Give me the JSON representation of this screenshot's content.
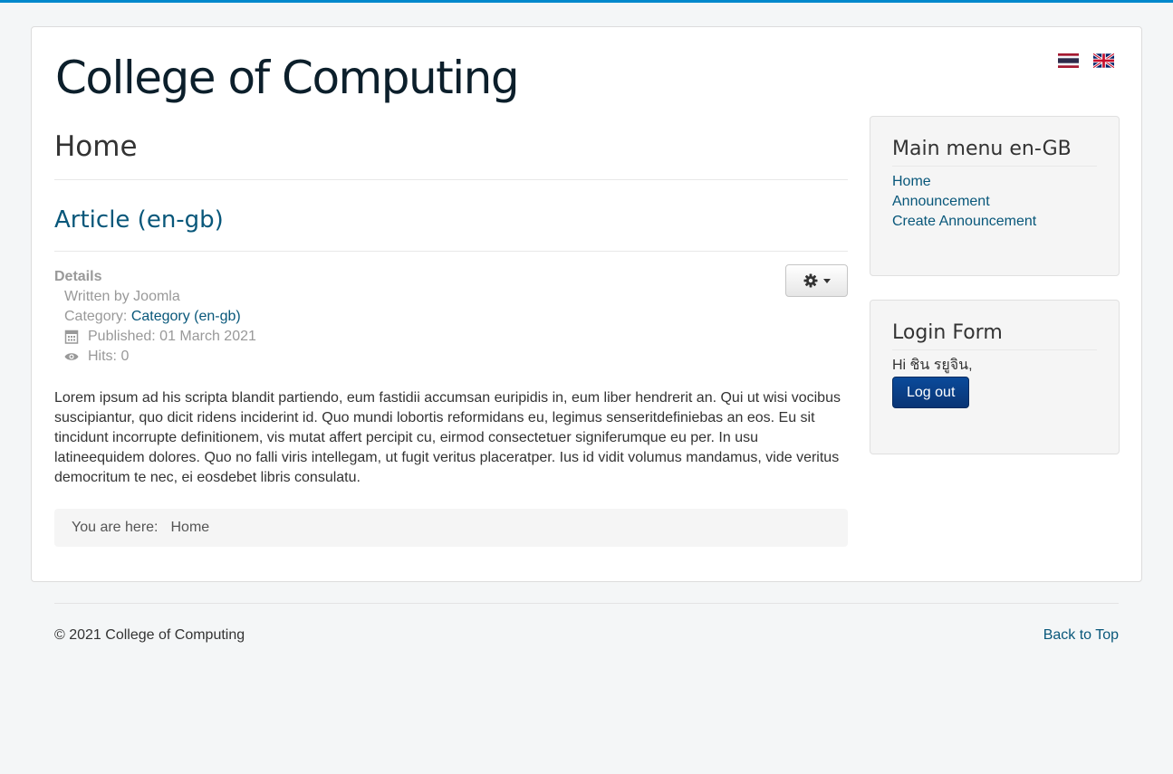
{
  "header": {
    "site_title": "College of Computing",
    "flags": [
      "thai-flag",
      "uk-flag"
    ]
  },
  "main": {
    "page_heading": "Home",
    "article_title": "Article (en-gb)",
    "details": {
      "heading": "Details",
      "written_by": "Written by Joomla",
      "category_label": "Category: ",
      "category_link": "Category (en-gb)",
      "published": "Published: 01 March 2021",
      "hits": "Hits: 0"
    },
    "body": "Lorem ipsum ad his scripta blandit partiendo, eum fastidii accumsan euripidis in, eum liber hendrerit an. Qui ut wisi vocibus suscipiantur, quo dicit ridens inciderint id. Quo mundi lobortis reformidans eu, legimus senseritdefiniebas an eos. Eu sit tincidunt incorrupte definitionem, vis mutat affert percipit cu, eirmod consectetuer signiferumque eu per. In usu latineequidem dolores. Quo no falli viris intellegam, ut fugit veritus placeratper. Ius id vidit volumus mandamus, vide veritus democritum te nec, ei eosdebet libris consulatu.",
    "breadcrumb": {
      "label": "You are here:",
      "current": "Home"
    }
  },
  "sidebar": {
    "main_menu": {
      "title": "Main menu en-GB",
      "items": [
        {
          "label": "Home"
        },
        {
          "label": "Announcement"
        },
        {
          "label": "Create Announcement"
        }
      ]
    },
    "login": {
      "title": "Login Form",
      "greeting": "Hi ชิน รยูจิน,",
      "logout_label": "Log out"
    }
  },
  "footer": {
    "copyright": "© 2021 College of Computing",
    "back_to_top": "Back to Top"
  },
  "colors": {
    "accent": "#0088cc",
    "link": "#08577a",
    "button": "#0a3f85"
  }
}
